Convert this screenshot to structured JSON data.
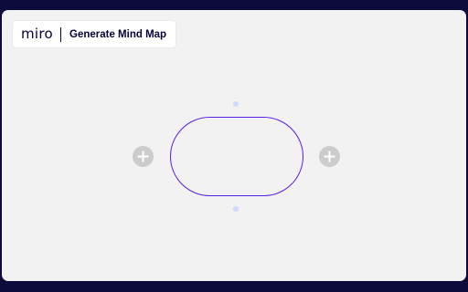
{
  "app": {
    "logo_text": "miro",
    "title": "Generate Mind Map"
  },
  "colors": {
    "frame_background": "#0b0a3a",
    "board_background": "#f2f2f2",
    "node_border": "#5a1ee6",
    "anchor_dot": "#cfd9ff",
    "add_button": "#cccccc",
    "divider": "#050038"
  },
  "icons": {
    "add_left": "plus-icon",
    "add_right": "plus-icon"
  }
}
